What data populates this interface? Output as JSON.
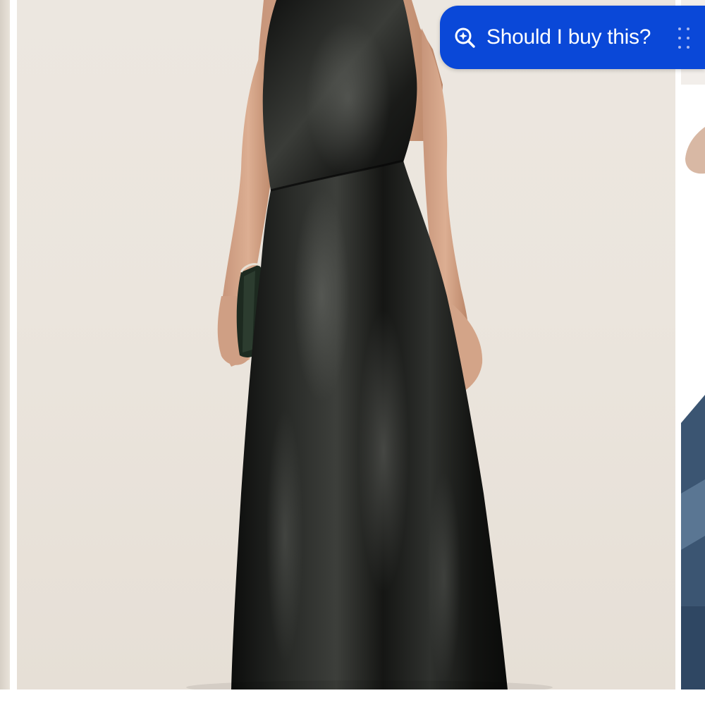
{
  "assistant_pill": {
    "label": "Should I buy this?",
    "icon": "sparkle-search-icon",
    "background_color": "#0a48d8",
    "text_color": "#ffffff"
  },
  "drag_handle": {
    "icon": "drag-handle-icon"
  },
  "product_image": {
    "subject": "black satin halter maxi dress",
    "backdrop_color": "#ebe5dd",
    "dress_color": "#151614"
  }
}
